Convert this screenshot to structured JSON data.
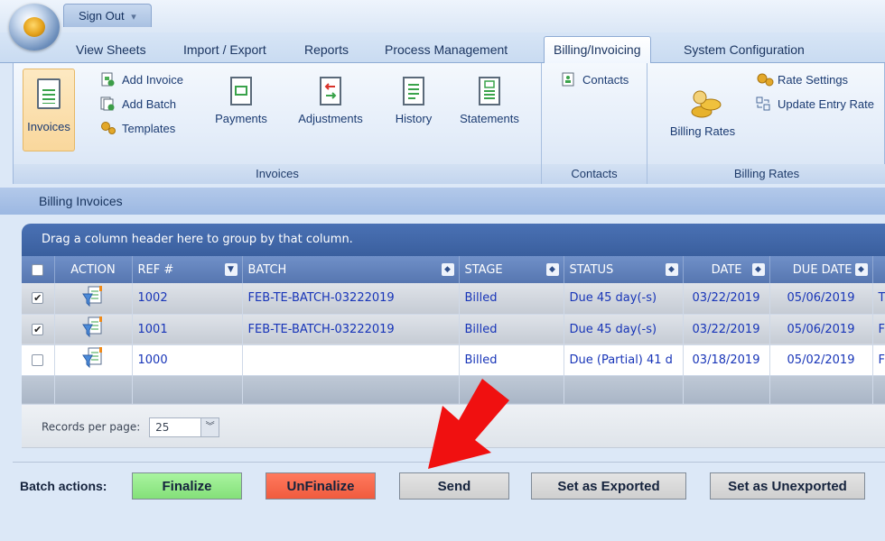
{
  "header": {
    "signout_label": "Sign Out",
    "signout_caret": "▾"
  },
  "tabs": [
    {
      "label": "View Sheets"
    },
    {
      "label": "Import / Export"
    },
    {
      "label": "Reports"
    },
    {
      "label": "Process Management"
    },
    {
      "label": "Billing/Invoicing"
    },
    {
      "label": "System Configuration"
    }
  ],
  "ribbon": {
    "invoices": {
      "big_invoices": "Invoices",
      "add_invoice": "Add Invoice",
      "add_batch": "Add Batch",
      "templates": "Templates",
      "payments": "Payments",
      "adjustments": "Adjustments",
      "history": "History",
      "statements": "Statements",
      "group_label": "Invoices"
    },
    "contacts": {
      "contacts": "Contacts",
      "group_label": "Contacts"
    },
    "billing_rates": {
      "billing_rates": "Billing Rates",
      "rate_settings": "Rate Settings",
      "update_entry_rates": "Update Entry Rate",
      "group_label": "Billing Rates"
    }
  },
  "section": {
    "title": "Billing Invoices"
  },
  "grid": {
    "group_hint": "Drag a column header here to group by that column.",
    "columns": [
      "ACTION",
      "REF #",
      "BATCH",
      "STAGE",
      "STATUS",
      "DATE",
      "DUE DATE"
    ],
    "rows": [
      {
        "checked": "✔",
        "ref": "1002",
        "batch": "FEB-TE-BATCH-03222019",
        "stage": "Billed",
        "status": "Due 45 day(-s)",
        "date": "03/22/2019",
        "due": "05/06/2019",
        "extra": "T"
      },
      {
        "checked": "✔",
        "ref": "1001",
        "batch": "FEB-TE-BATCH-03222019",
        "stage": "Billed",
        "status": "Due 45 day(-s)",
        "date": "03/22/2019",
        "due": "05/06/2019",
        "extra": "F"
      },
      {
        "checked": "",
        "ref": "1000",
        "batch": "",
        "stage": "Billed",
        "status": "Due (Partial) 41 d",
        "date": "03/18/2019",
        "due": "05/02/2019",
        "extra": "F"
      }
    ],
    "records_per_page_label": "Records per page:",
    "records_per_page_value": "25"
  },
  "batch": {
    "label": "Batch actions:",
    "finalize": "Finalize",
    "unfinalize": "UnFinalize",
    "send": "Send",
    "set_exported": "Set as Exported",
    "set_unexported": "Set as Unexported"
  },
  "colors": {
    "finalize": "#8ee684",
    "unfinalize": "#f4654a",
    "arrow": "#f01010",
    "ribbon_highlight": "#fbdca6"
  }
}
